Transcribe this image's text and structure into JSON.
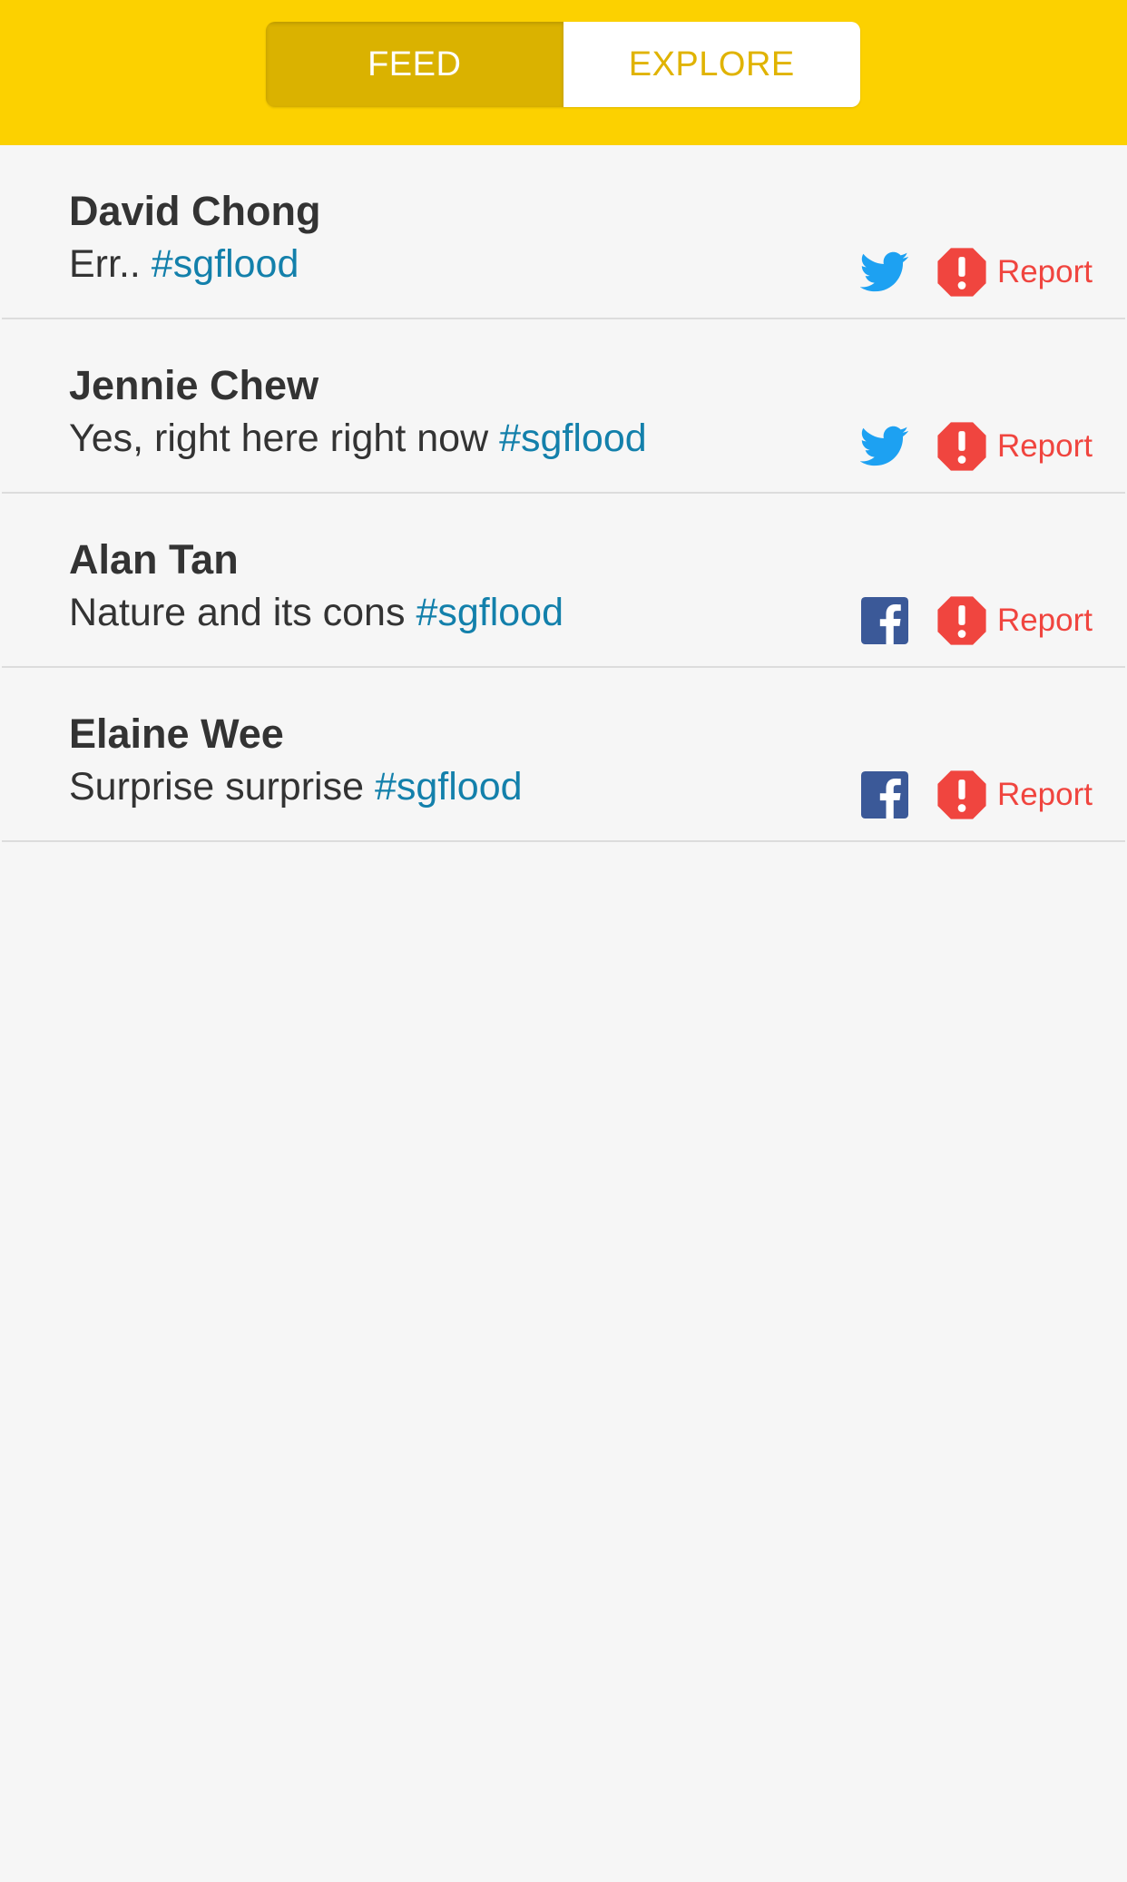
{
  "tabs": {
    "feed": "FEED",
    "explore": "EXPLORE",
    "active": "feed"
  },
  "colors": {
    "topbar": "#fcd100",
    "active_tab": "#dab200",
    "hashtag": "#1380ab",
    "report": "#f0453f",
    "twitter": "#1da1f2",
    "facebook": "#3b5998"
  },
  "posts": [
    {
      "name": "David Chong",
      "text": "Err.. ",
      "hashtag": "#sgflood",
      "source_icon": "twitter-icon",
      "report_label": "Report"
    },
    {
      "name": "Jennie Chew",
      "text": "Yes, right here right now ",
      "hashtag": "#sgflood",
      "source_icon": "twitter-icon",
      "report_label": "Report"
    },
    {
      "name": "Alan Tan",
      "text": "Nature and its cons ",
      "hashtag": "#sgflood",
      "source_icon": "facebook-icon",
      "report_label": "Report"
    },
    {
      "name": "Elaine Wee",
      "text": "Surprise surprise ",
      "hashtag": "#sgflood",
      "source_icon": "facebook-icon",
      "report_label": "Report"
    }
  ]
}
